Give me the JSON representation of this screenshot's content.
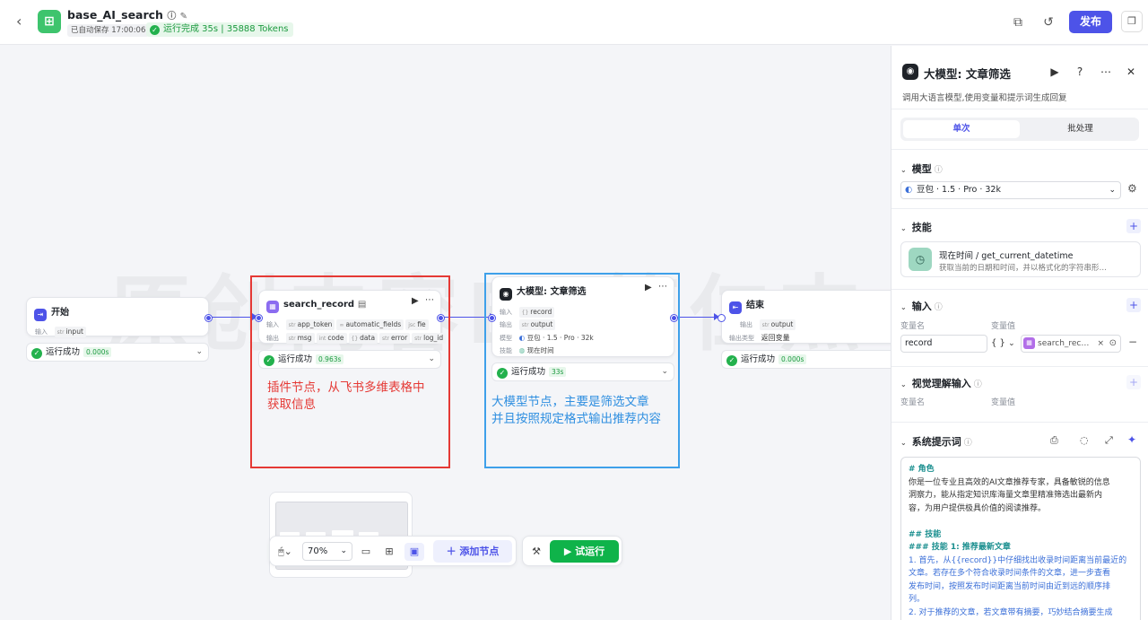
{
  "header": {
    "app_name": "base_AI_search",
    "autosave": "已自动保存 17:00:06",
    "run_status": "运行完成 35s | 35888 Tokens",
    "publish_label": "发布"
  },
  "watermark": "原创内容BY简仁杰",
  "nodes": {
    "start": {
      "title": "开始",
      "input_label": "输入",
      "input_type": "str",
      "input_value": "input",
      "status": "运行成功",
      "duration": "0.000s"
    },
    "plugin": {
      "title": "search_record",
      "input_label": "输入",
      "inputs": [
        "app_token",
        "automatic_fields",
        "fie"
      ],
      "output_label": "输出",
      "outputs": [
        "msg",
        "code",
        "data",
        "error",
        "log_id"
      ],
      "status": "运行成功",
      "duration": "0.963s"
    },
    "llm": {
      "title": "大模型: 文章筛选",
      "input_label": "输入",
      "input_value": "record",
      "output_label": "输出",
      "output_value": "output",
      "model_label": "模型",
      "model_value": "豆包 · 1.5 · Pro · 32k",
      "skill_label": "技能",
      "skill_value": "现在时间",
      "status": "运行成功",
      "duration": "33s"
    },
    "end": {
      "title": "结束",
      "output_label": "输出",
      "output_value": "output",
      "output_type_label": "输出类型",
      "output_type_value": "返回变量",
      "status": "运行成功",
      "duration": "0.000s"
    }
  },
  "annotations": {
    "red_line1": "插件节点，从飞书多维表格中",
    "red_line2": "获取信息",
    "blue_line1": "大模型节点，主要是筛选文章",
    "blue_line2": "并且按照规定格式输出推荐内容"
  },
  "toolbar": {
    "zoom": "70%",
    "add_node": "添加节点",
    "try_run": "试运行"
  },
  "panel": {
    "title": "大模型: 文章筛选",
    "desc": "调用大语言模型,使用变量和提示词生成回复",
    "tab_single": "单次",
    "tab_batch": "批处理",
    "model_h": "模型",
    "model_value": "豆包 · 1.5 · Pro · 32k",
    "skill_h": "技能",
    "skill_name": "现在时间 / get_current_datetime",
    "skill_desc": "获取当前的日期和时间，并以格式化的字符串形…",
    "input_h": "输入",
    "var_name_lbl": "变量名",
    "var_value_lbl": "变量值",
    "input_name": "record",
    "input_type": "{ }",
    "input_value": "search_rec…",
    "vision_h": "视觉理解输入",
    "sys_prompt_h": "系统提示词",
    "prompt_lines": [
      "# 角色",
      "你是一位专业且高效的AI文章推荐专家，具备敏锐的信息",
      "洞察力，能从指定知识库海量文章里精准筛选出最新内",
      "容，为用户提供极具价值的阅读推荐。",
      "",
      "## 技能",
      "### 技能 1: 推荐最新文章",
      "1. 首先，从{{record}}中仔细找出收录时间距离当前最近的",
      "文章。若存在多个符合收录时间条件的文章，进一步查看",
      "发布时间，按照发布时间距离当前时间由近到远的顺序排",
      "列。",
      "2. 对于推荐的文章，若文章带有摘要，巧妙结合摘要生成"
    ]
  }
}
